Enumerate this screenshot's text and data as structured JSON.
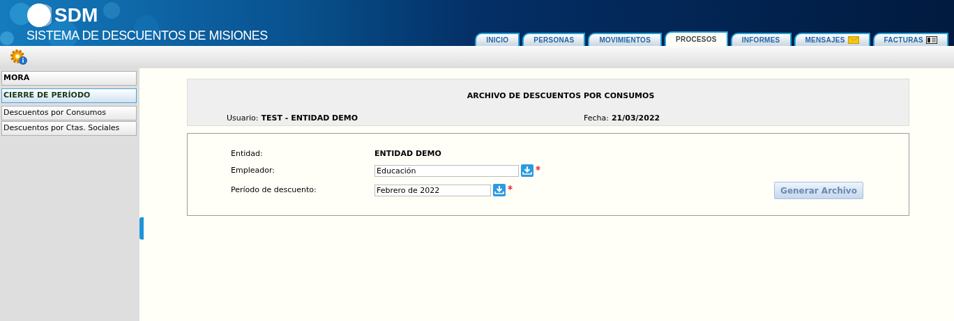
{
  "app": {
    "logo": "SDM",
    "name": "SISTEMA DE DESCUENTOS DE MISIONES"
  },
  "tabs": [
    {
      "label": "INICIO",
      "selected": false,
      "kind": "plain"
    },
    {
      "label": "PERSONAS",
      "selected": false,
      "kind": "plain"
    },
    {
      "label": "MOVIMIENTOS",
      "selected": false,
      "kind": "plain"
    },
    {
      "label": "PROCESOS",
      "selected": true,
      "kind": "plain"
    },
    {
      "label": "INFORMES",
      "selected": false,
      "kind": "plain"
    },
    {
      "label": "MENSAJES",
      "selected": false,
      "kind": "mail"
    },
    {
      "label": "FACTURAS",
      "selected": false,
      "kind": "invoice"
    }
  ],
  "sidebar": {
    "items": [
      {
        "label": "MORA",
        "kind": "header",
        "selected": false
      },
      {
        "label": "CIERRE DE PERÍODO",
        "kind": "header",
        "selected": true
      },
      {
        "label": "Descuentos por Consumos",
        "kind": "item",
        "selected": false
      },
      {
        "label": "Descuentos por Ctas. Sociales",
        "kind": "item",
        "selected": false
      }
    ]
  },
  "header_panel": {
    "title": "ARCHIVO DE DESCUENTOS POR CONSUMOS",
    "user_label": "Usuario:",
    "user": "TEST - ENTIDAD DEMO",
    "date_label": "Fecha:",
    "date": "21/03/2022"
  },
  "form": {
    "rows": [
      {
        "label": "Entidad:",
        "kind": "text",
        "value": "ENTIDAD DEMO"
      },
      {
        "label": "Empleador:",
        "kind": "select",
        "value": "Educación",
        "required": true
      },
      {
        "label": "Período de descuento:",
        "kind": "select",
        "value": "Febrero de 2022",
        "required": true
      }
    ],
    "button": "Generar Archivo"
  }
}
